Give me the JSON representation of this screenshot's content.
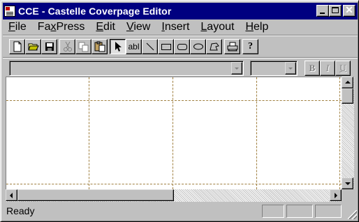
{
  "window": {
    "title": "CCE - Castelle Coverpage Editor"
  },
  "menu": [
    {
      "pre": "",
      "u": "F",
      "post": "ile"
    },
    {
      "pre": "Fa",
      "u": "x",
      "post": "Press"
    },
    {
      "pre": "",
      "u": "E",
      "post": "dit"
    },
    {
      "pre": "",
      "u": "V",
      "post": "iew"
    },
    {
      "pre": "",
      "u": "I",
      "post": "nsert"
    },
    {
      "pre": "",
      "u": "L",
      "post": "ayout"
    },
    {
      "pre": "",
      "u": "H",
      "post": "elp"
    }
  ],
  "toolbar": {
    "text_tool_label": "abl"
  },
  "format": {
    "font_value": "",
    "size_value": "",
    "bold": "B",
    "italic": "I",
    "underline": "U"
  },
  "status": {
    "text": "Ready"
  },
  "colors": {
    "titlebar": "#000080",
    "face": "#c0c0c0",
    "guide": "#a08040"
  }
}
